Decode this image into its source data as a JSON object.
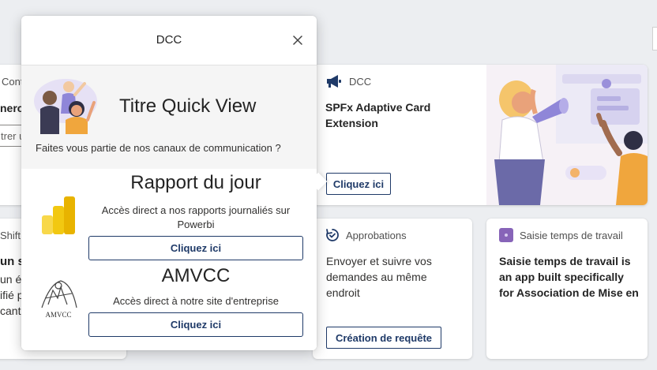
{
  "colors": {
    "accent": "#1f3a68",
    "canvas": "#eceef1",
    "purple": "#8764b8"
  },
  "bg_cards": {
    "left_top": {
      "head": "Cont",
      "title_fragment": "nerch",
      "input_fragment": "trer u"
    },
    "left_bottom": {
      "head": "Shift",
      "title_fragment": "un s",
      "lines": [
        "un él",
        "ifié p",
        "cant."
      ]
    }
  },
  "dcc_card": {
    "icon": "megaphone-icon",
    "app_name": "DCC",
    "title_line1": "SPFx Adaptive Card",
    "title_line2": "Extension",
    "button": "Cliquez ici"
  },
  "approbations_card": {
    "icon": "approvals-icon",
    "app_name": "Approbations",
    "lines": [
      "Envoyer et suivre vos",
      "demandes au même",
      "endroit"
    ],
    "button": "Création de requête"
  },
  "saisie_card": {
    "icon": "timesheet-icon",
    "app_name": "Saisie temps de travail",
    "lines": [
      "Saisie temps de travail is",
      "an app built specifically",
      "for Association de Mise en"
    ]
  },
  "quick_view": {
    "title": "DCC",
    "close_icon": "close-icon",
    "heading": "Titre Quick View",
    "subtitle": "Faites vous partie de nos canaux de communication ?",
    "sections": [
      {
        "icon": "powerbi-icon",
        "title": "Rapport du jour",
        "desc_line1": "Accès direct a nos rapports journaliés sur",
        "desc_line2": "Powerbi",
        "button": "Cliquez ici"
      },
      {
        "icon": "amvcc-logo",
        "logo_text": "AMVCC",
        "title": "AMVCC",
        "desc_line1": "Accès direct à notre site d'entreprise",
        "button": "Cliquez ici"
      }
    ]
  }
}
